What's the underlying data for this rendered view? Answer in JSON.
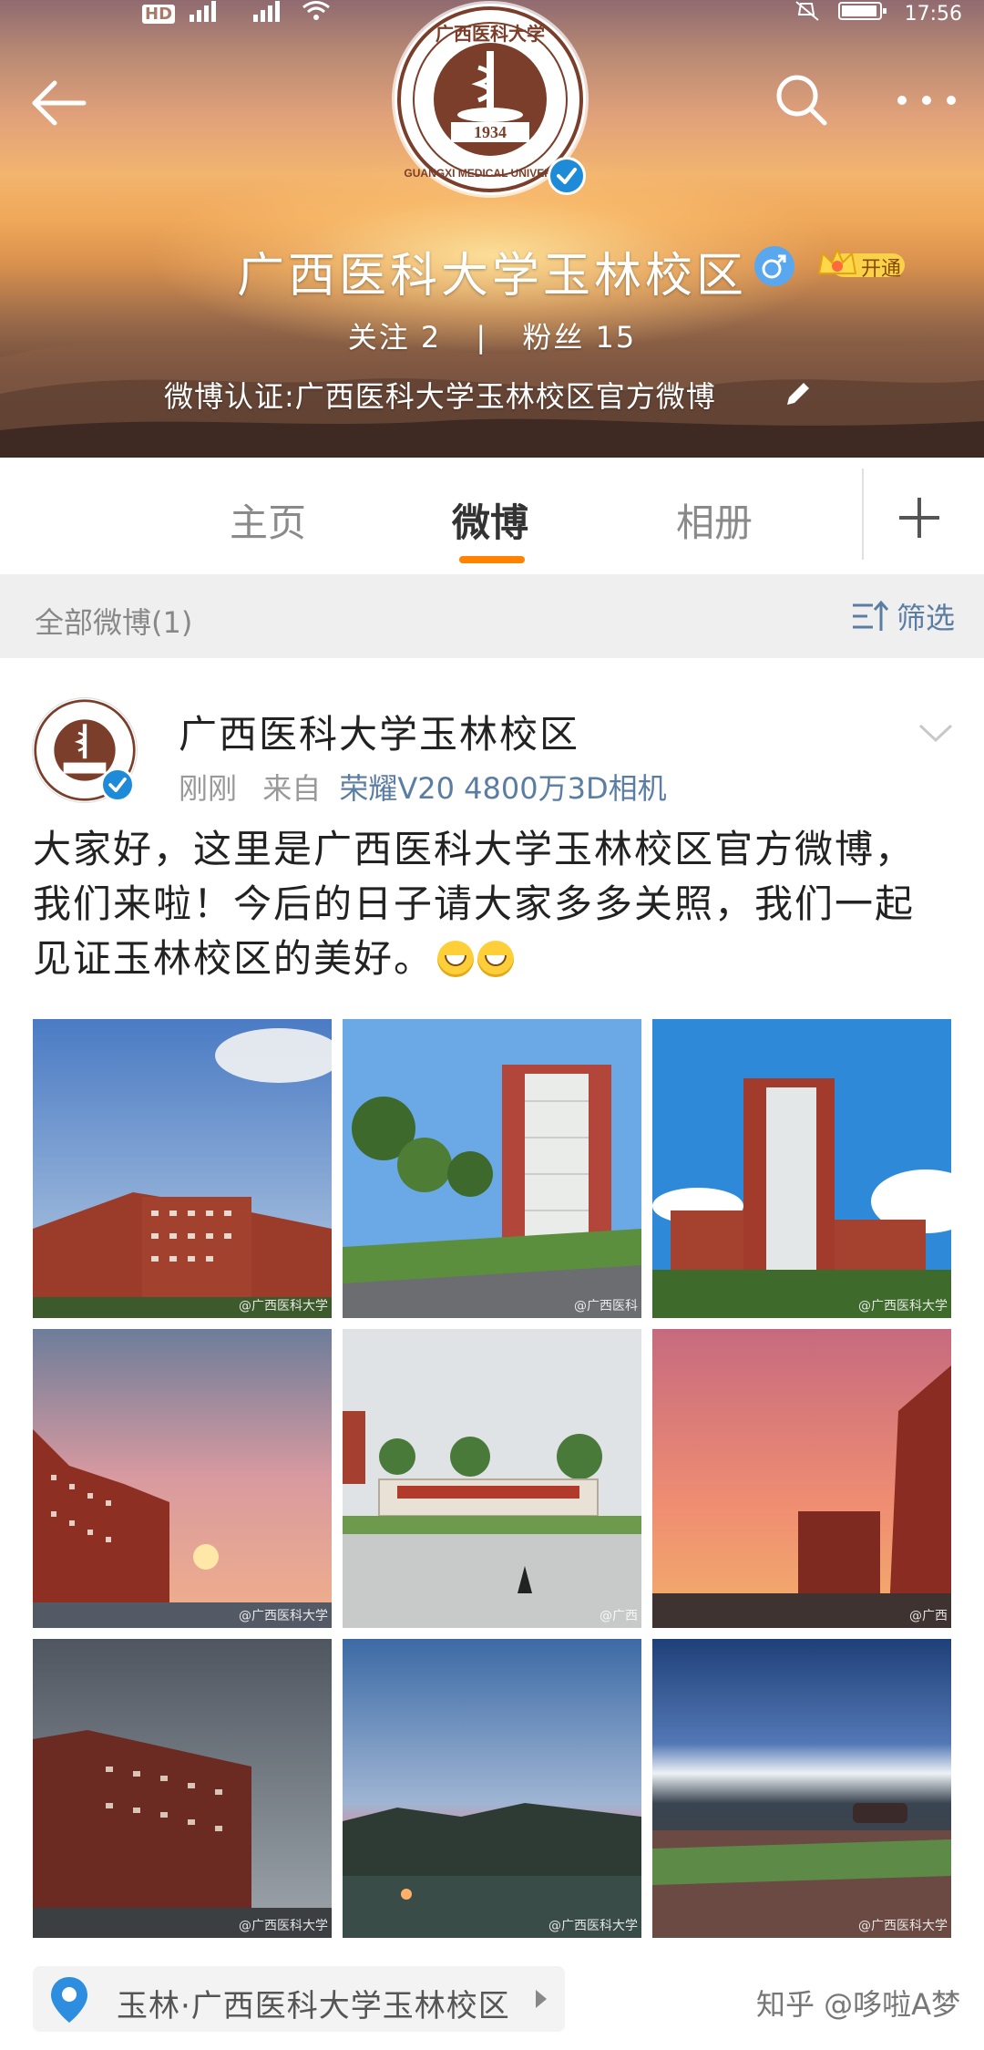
{
  "status_bar": {
    "left_label": "HD",
    "left_sub": "2",
    "time": "17:56"
  },
  "header": {
    "profile_name": "广西医科大学玉林校区",
    "vip_label": "开通",
    "follow_label": "关注 2",
    "fans_label": "粉丝 15",
    "verification": "微博认证:广西医科大学玉林校区官方微博",
    "logo_year": "1934",
    "logo_top_text": "广西医科大学",
    "logo_bottom_text": "GUANGXI MEDICAL UNIVERSITY"
  },
  "tabs": {
    "items": [
      {
        "label": "主页"
      },
      {
        "label": "微博"
      },
      {
        "label": "相册"
      }
    ]
  },
  "filter": {
    "title": "全部微博(1)",
    "button": "筛选"
  },
  "post": {
    "author": "广西医科大学玉林校区",
    "time": "刚刚",
    "from_label": "来自",
    "source": "荣耀V20 4800万3D相机",
    "text": "大家好，这里是广西医科大学玉林校区官方微博，我们来啦！今后的日子请大家多多关照，我们一起见证玉林校区的美好。",
    "photos": [
      {
        "watermark": "@广西医科大学"
      },
      {
        "watermark": "@广西医科"
      },
      {
        "watermark": "@广西医科大学"
      },
      {
        "watermark": "@广西医科大学"
      },
      {
        "watermark": "@广西"
      },
      {
        "watermark": "@广西"
      },
      {
        "watermark": "@广西医科大学"
      },
      {
        "watermark": "@广西医科大学"
      },
      {
        "watermark": "@广西医科大学"
      }
    ],
    "location": "玉林·广西医科大学玉林校区"
  },
  "footer_watermark": "知乎 @哆啦A梦",
  "colors": {
    "accent": "#ff8200",
    "link": "#5b7da3",
    "verified": "#1e8bd8",
    "logo_brown": "#7a3e2a"
  }
}
